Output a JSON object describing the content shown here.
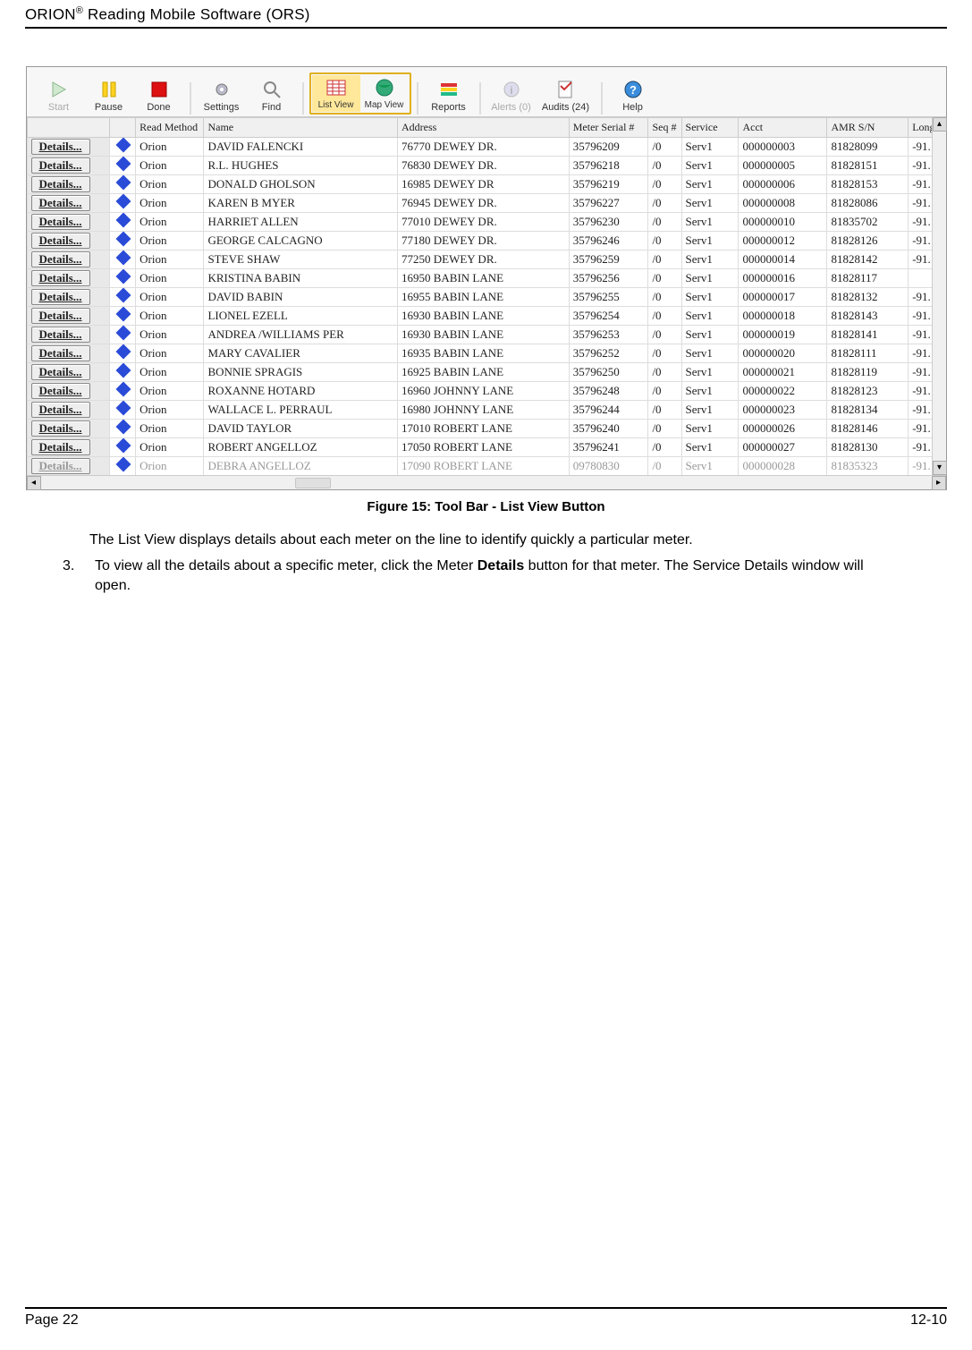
{
  "doc_header": "ORION® Reading Mobile Software (ORS)",
  "caption": "Figure 15:   Tool Bar - List View Button",
  "body_line": "The List View displays details about each meter on the line to identify quickly a particular meter.",
  "step_num": "3.",
  "step_text_a": "To view all the details about a specific meter, click the Meter ",
  "step_bold": "Details",
  "step_text_b": " button for that meter. The Service Details window will open.",
  "footer_left": "Page 22",
  "footer_right": "12-10",
  "toolbar": {
    "start": "Start",
    "pause": "Pause",
    "done": "Done",
    "settings": "Settings",
    "find": "Find",
    "listview": "List View",
    "mapview": "Map View",
    "reports": "Reports",
    "alerts": "Alerts (0)",
    "audits": "Audits (24)",
    "help": "Help"
  },
  "columns": {
    "read_method": "Read Method",
    "name": "Name",
    "address": "Address",
    "meter_serial": "Meter Serial #",
    "seq": "Seq #",
    "service": "Service",
    "acct": "Acct",
    "amr": "AMR S/N",
    "long": "Long"
  },
  "details_label": "Details...",
  "rows": [
    {
      "method": "Orion",
      "name": "DAVID FALENCKI",
      "address": "76770 DEWEY DR.",
      "serial": "35796209",
      "seq": "/0",
      "service": "Serv1",
      "acct": "000000003",
      "amr": "81828099",
      "long": "-91."
    },
    {
      "method": "Orion",
      "name": "R.L. HUGHES",
      "address": "76830 DEWEY DR.",
      "serial": "35796218",
      "seq": "/0",
      "service": "Serv1",
      "acct": "000000005",
      "amr": "81828151",
      "long": "-91."
    },
    {
      "method": "Orion",
      "name": "DONALD GHOLSON",
      "address": "16985 DEWEY DR",
      "serial": "35796219",
      "seq": "/0",
      "service": "Serv1",
      "acct": "000000006",
      "amr": "81828153",
      "long": "-91."
    },
    {
      "method": "Orion",
      "name": "KAREN B MYER",
      "address": "76945 DEWEY DR.",
      "serial": "35796227",
      "seq": "/0",
      "service": "Serv1",
      "acct": "000000008",
      "amr": "81828086",
      "long": "-91."
    },
    {
      "method": "Orion",
      "name": "HARRIET ALLEN",
      "address": "77010 DEWEY DR.",
      "serial": "35796230",
      "seq": "/0",
      "service": "Serv1",
      "acct": "000000010",
      "amr": "81835702",
      "long": "-91."
    },
    {
      "method": "Orion",
      "name": "GEORGE  CALCAGNO",
      "address": "77180 DEWEY DR.",
      "serial": "35796246",
      "seq": "/0",
      "service": "Serv1",
      "acct": "000000012",
      "amr": "81828126",
      "long": "-91."
    },
    {
      "method": "Orion",
      "name": "STEVE SHAW",
      "address": "77250 DEWEY DR.",
      "serial": "35796259",
      "seq": "/0",
      "service": "Serv1",
      "acct": "000000014",
      "amr": "81828142",
      "long": "-91."
    },
    {
      "method": "Orion",
      "name": "KRISTINA BABIN",
      "address": "16950 BABIN LANE",
      "serial": "35796256",
      "seq": "/0",
      "service": "Serv1",
      "acct": "000000016",
      "amr": "81828117",
      "long": ""
    },
    {
      "method": "Orion",
      "name": "DAVID BABIN",
      "address": "16955 BABIN LANE",
      "serial": "35796255",
      "seq": "/0",
      "service": "Serv1",
      "acct": "000000017",
      "amr": "81828132",
      "long": "-91."
    },
    {
      "method": "Orion",
      "name": "LIONEL EZELL",
      "address": "16930 BABIN LANE",
      "serial": "35796254",
      "seq": "/0",
      "service": "Serv1",
      "acct": "000000018",
      "amr": "81828143",
      "long": "-91."
    },
    {
      "method": "Orion",
      "name": "ANDREA /WILLIAMS PER",
      "address": "16930 BABIN LANE",
      "serial": "35796253",
      "seq": "/0",
      "service": "Serv1",
      "acct": "000000019",
      "amr": "81828141",
      "long": "-91."
    },
    {
      "method": "Orion",
      "name": "MARY   CAVALIER",
      "address": "16935 BABIN LANE",
      "serial": "35796252",
      "seq": "/0",
      "service": "Serv1",
      "acct": "000000020",
      "amr": "81828111",
      "long": "-91."
    },
    {
      "method": "Orion",
      "name": "BONNIE  SPRAGIS",
      "address": "16925 BABIN LANE",
      "serial": "35796250",
      "seq": "/0",
      "service": "Serv1",
      "acct": "000000021",
      "amr": "81828119",
      "long": "-91."
    },
    {
      "method": "Orion",
      "name": "ROXANNE HOTARD",
      "address": "16960 JOHNNY LANE",
      "serial": "35796248",
      "seq": "/0",
      "service": "Serv1",
      "acct": "000000022",
      "amr": "81828123",
      "long": "-91."
    },
    {
      "method": "Orion",
      "name": "WALLACE  L.  PERRAUL",
      "address": "16980 JOHNNY LANE",
      "serial": "35796244",
      "seq": "/0",
      "service": "Serv1",
      "acct": "000000023",
      "amr": "81828134",
      "long": "-91."
    },
    {
      "method": "Orion",
      "name": "DAVID  TAYLOR",
      "address": "17010 ROBERT LANE",
      "serial": "35796240",
      "seq": "/0",
      "service": "Serv1",
      "acct": "000000026",
      "amr": "81828146",
      "long": "-91."
    },
    {
      "method": "Orion",
      "name": "ROBERT ANGELLOZ",
      "address": "17050 ROBERT LANE",
      "serial": "35796241",
      "seq": "/0",
      "service": "Serv1",
      "acct": "000000027",
      "amr": "81828130",
      "long": "-91."
    }
  ],
  "cutoff_row": {
    "method": "Orion",
    "name": "DEBRA  ANGELLOZ",
    "address": "17090 ROBERT LANE",
    "serial": "09780830",
    "seq": "/0",
    "service": "Serv1",
    "acct": "000000028",
    "amr": "81835323",
    "long": "-91."
  }
}
